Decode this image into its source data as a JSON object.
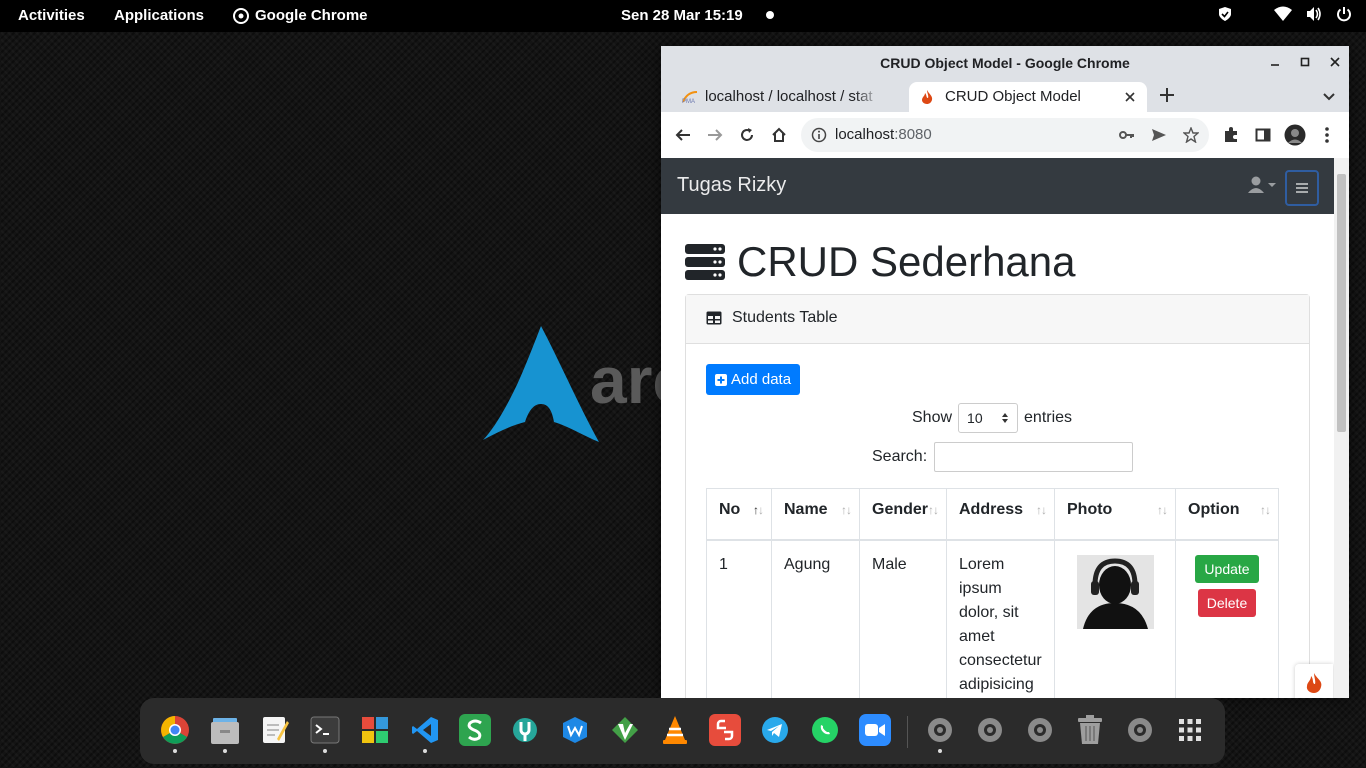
{
  "topbar": {
    "activities": "Activities",
    "applications": "Applications",
    "app_name": "Google Chrome",
    "datetime": "Sen 28 Mar  15:19"
  },
  "wallpaper": {
    "logo_text": "arc"
  },
  "window": {
    "title": "CRUD Object Model - Google Chrome",
    "tabs": [
      {
        "label": "localhost / localhost / stat"
      },
      {
        "label": "CRUD Object Model"
      }
    ],
    "url_host": "localhost",
    "url_port": ":8080"
  },
  "page": {
    "brand": "Tugas Rizky",
    "heading": "CRUD Sederhana",
    "card_title": "Students Table",
    "add_button": "Add data",
    "show_label": "Show",
    "entries_value": "10",
    "entries_label": "entries",
    "search_label": "Search:",
    "table": {
      "headers": [
        "No",
        "Name",
        "Gender",
        "Address",
        "Photo",
        "Option"
      ],
      "rows": [
        {
          "no": "1",
          "name": "Agung",
          "gender": "Male",
          "address": "Lorem ipsum dolor, sit amet consectetur adipisicing"
        }
      ],
      "update_label": "Update",
      "delete_label": "Delete"
    }
  },
  "colors": {
    "navbar": "#343a40",
    "primary": "#007bff",
    "success": "#28a745",
    "danger": "#dc3545"
  },
  "dock": {
    "apps": [
      "chrome-icon",
      "files-icon",
      "text-editor-icon",
      "terminal-icon",
      "software-center-icon",
      "vscode-icon",
      "wps-spreadsheet-icon",
      "settings-tool-icon",
      "wps-writer-icon",
      "vim-icon",
      "vlc-icon",
      "python-icon",
      "telegram-icon",
      "whatsapp-icon",
      "zoom-icon",
      "app-gear-icon",
      "app-gear-icon",
      "app-gear-icon",
      "trash-icon",
      "app-gear-icon",
      "app-grid-icon"
    ]
  }
}
